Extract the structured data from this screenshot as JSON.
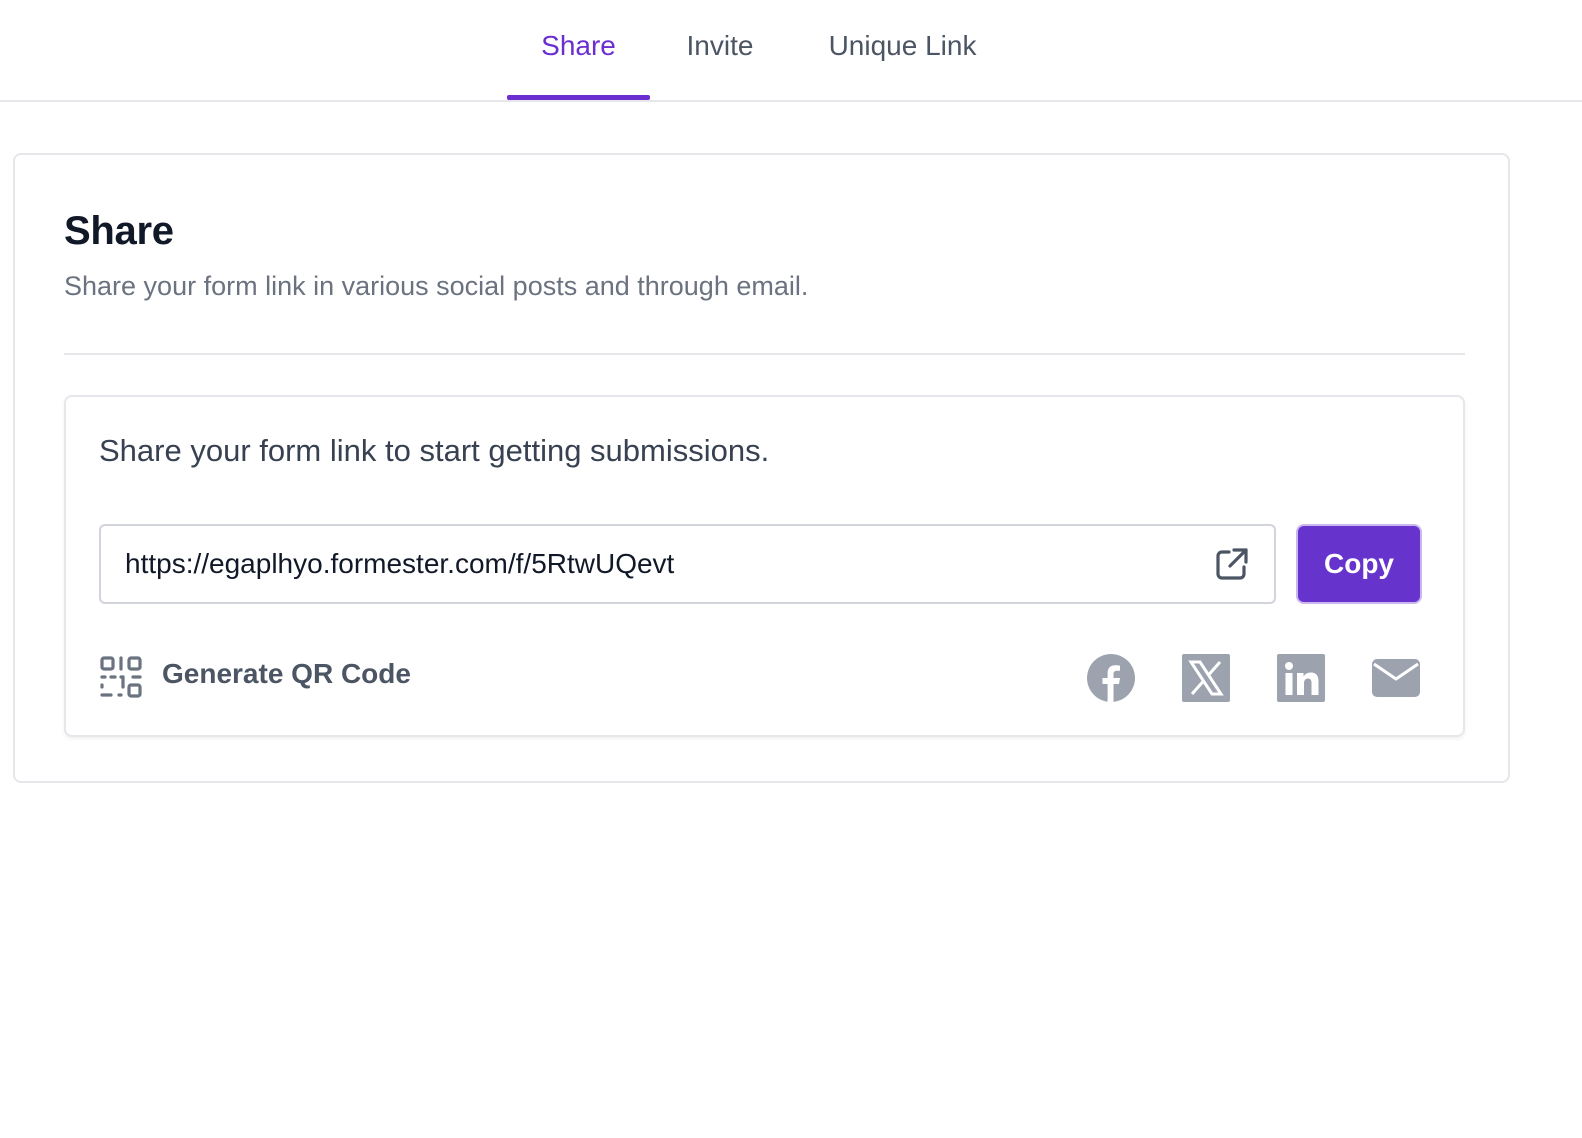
{
  "tabs": [
    {
      "label": "Share",
      "active": true
    },
    {
      "label": "Invite",
      "active": false
    },
    {
      "label": "Unique Link",
      "active": false
    }
  ],
  "share_section": {
    "title": "Share",
    "description": "Share your form link in various social posts and through email."
  },
  "link_panel": {
    "prompt": "Share your form link to start getting submissions.",
    "url": "https://egaplhyo.formester.com/f/5RtwUQevt",
    "copy_label": "Copy",
    "qr_label": "Generate QR Code"
  },
  "social_icons": [
    "facebook-icon",
    "x-twitter-icon",
    "linkedin-icon",
    "email-icon"
  ],
  "colors": {
    "accent": "#6b2fd1",
    "button": "#6633cc",
    "icon_gray": "#9ca3af",
    "text_muted": "#6b7280"
  }
}
